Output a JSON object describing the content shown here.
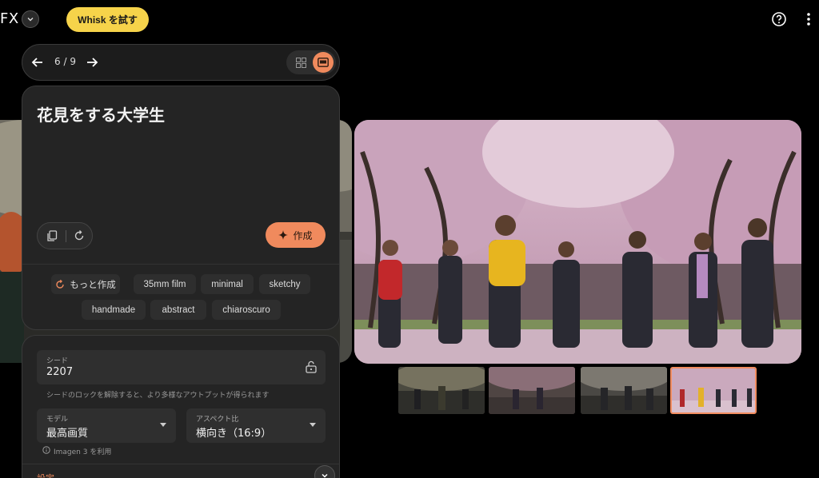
{
  "header": {
    "brand": "FX",
    "whisk_label": "Whisk を試す"
  },
  "navigator": {
    "counter": "6 / 9"
  },
  "prompt": {
    "title": "花見をする大学生",
    "create_label": "作成"
  },
  "suggestions": {
    "more_label": "もっと作成",
    "chips": [
      "35mm film",
      "minimal",
      "sketchy",
      "handmade",
      "abstract",
      "chiaroscuro"
    ]
  },
  "settings": {
    "seed_label": "シード",
    "seed_value": "2207",
    "seed_hint": "シードのロックを解除すると、より多様なアウトプットが得られます",
    "model_label": "モデル",
    "model_value": "最高画質",
    "aspect_label": "アスペクト比",
    "aspect_value": "横向き（16:9）",
    "imagen_hint": "Imagen 3 を利用",
    "section_label": "設定"
  },
  "colors": {
    "accent": "#f08a5d",
    "whisk_yellow": "#f6d34a",
    "panel": "#242424"
  },
  "icons": [
    "chevron-down-icon",
    "help-icon",
    "more-vert-icon",
    "arrow-back-icon",
    "arrow-forward-icon",
    "grid-view-icon",
    "single-view-icon",
    "copy-icon",
    "refresh-icon",
    "sparkle-icon",
    "lock-open-icon",
    "info-icon"
  ]
}
